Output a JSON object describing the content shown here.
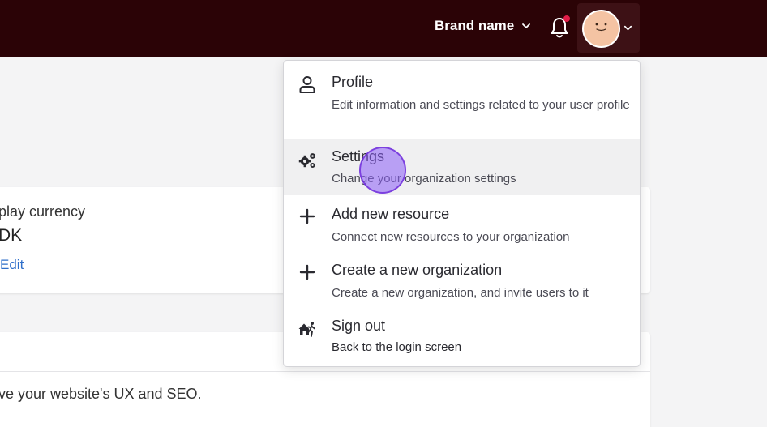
{
  "header": {
    "brand_label": "Brand name",
    "notification_badge_color": "#e11d48",
    "background_color": "#2b0306"
  },
  "card_currency": {
    "label": "play currency",
    "value": "DK",
    "edit_link": "Edit"
  },
  "card_seo": {
    "text": "ve your website's UX and SEO."
  },
  "user_menu": {
    "items": [
      {
        "title": "Profile",
        "description": "Edit information and settings related to your user profile",
        "icon": "user-icon"
      },
      {
        "title": "Settings",
        "description": "Change your organization settings",
        "icon": "gears-icon",
        "state": "hovered"
      },
      {
        "title": "Add new resource",
        "description": "Connect new resources to your organization",
        "icon": "plus-icon"
      },
      {
        "title": "Create a new organization",
        "description": "Create a new organization, and invite users to it",
        "icon": "plus-icon"
      },
      {
        "title": "Sign out",
        "description": "Back to the login screen",
        "icon": "exit-house-icon"
      }
    ]
  }
}
